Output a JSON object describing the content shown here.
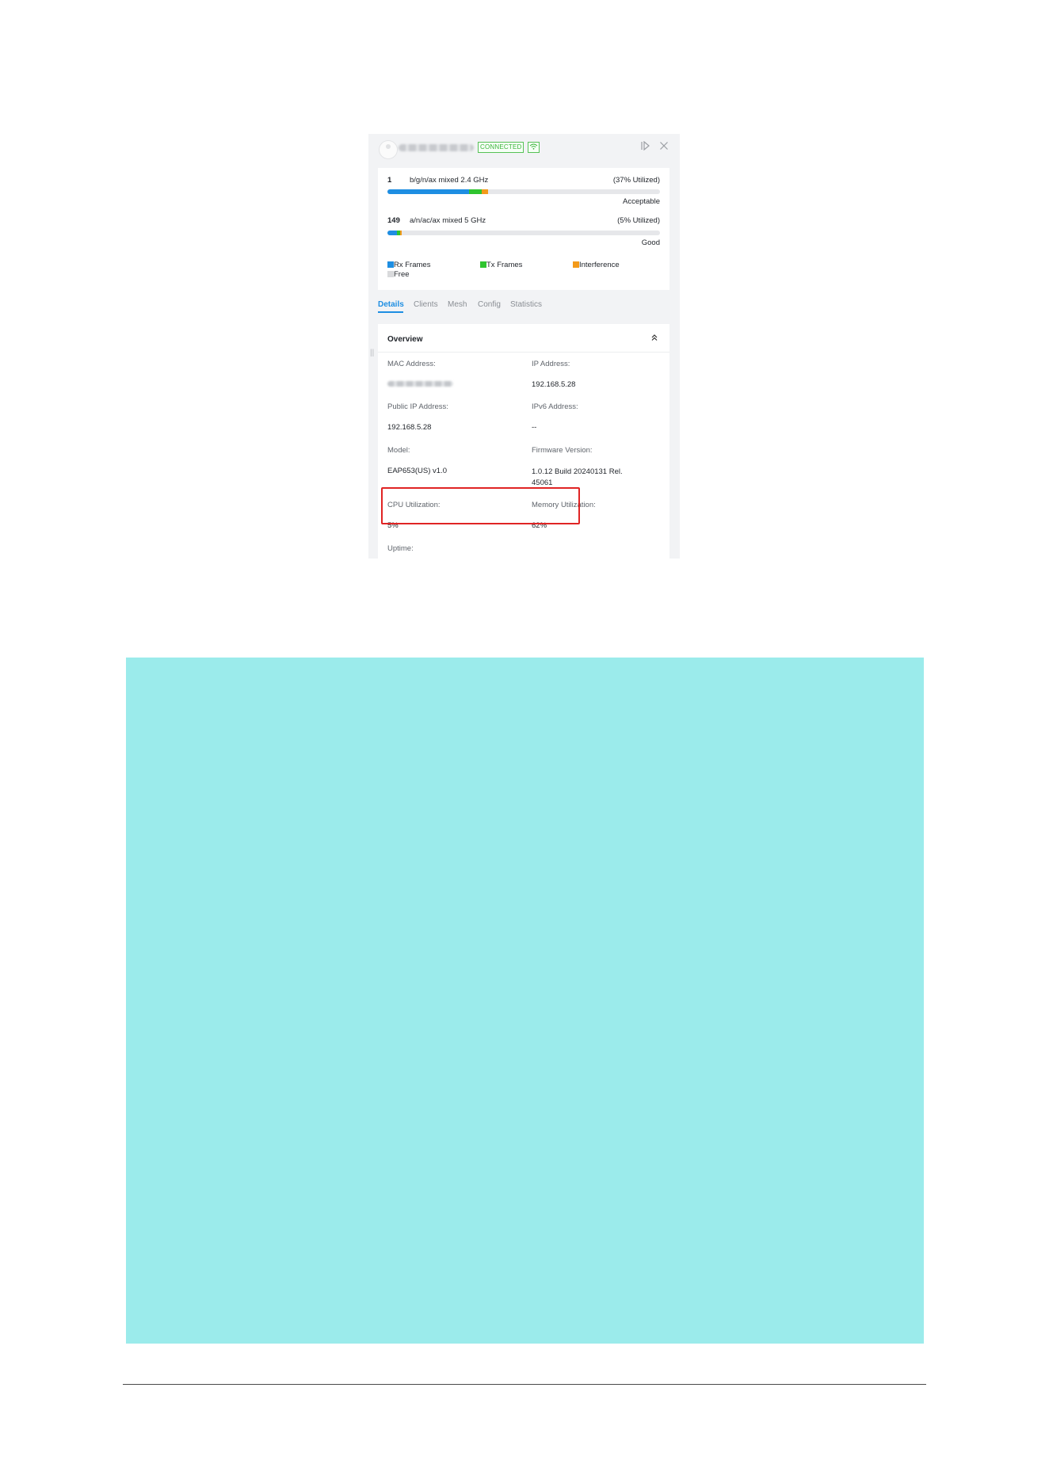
{
  "header": {
    "status_badge": "CONNECTED",
    "wifi_icon": "wifi-icon",
    "collapse_panel_icon": "panel-collapse-icon",
    "close_icon": "close-icon"
  },
  "radios": [
    {
      "channel": "1",
      "mode": "b/g/n/ax mixed  2.4 GHz",
      "utilization": "(37% Utilized)",
      "quality": "Acceptable",
      "rx_pct": 30,
      "tx_pct": 4.5,
      "interference_pct": 2.5
    },
    {
      "channel": "149",
      "mode": "a/n/ac/ax mixed  5 GHz",
      "utilization": "(5% Utilized)",
      "quality": "Good",
      "rx_pct": 3.5,
      "tx_pct": 1.2,
      "interference_pct": 0.5
    }
  ],
  "legend": {
    "rx": "Rx Frames",
    "tx": "Tx Frames",
    "interference": "Interference",
    "free": "Free"
  },
  "colors": {
    "rx": "#1e8ee2",
    "tx": "#2fc42f",
    "interference": "#f39a1a",
    "free": "#d9dadc",
    "accent": "#1e8ee2",
    "highlight": "#e02424",
    "background_block": "#9bebeb"
  },
  "tabs": [
    "Details",
    "Clients",
    "Mesh",
    "Config",
    "Statistics"
  ],
  "active_tab": "Details",
  "overview": {
    "title": "Overview",
    "mac_label": "MAC Address:",
    "ip_label": "IP Address:",
    "ip_value": "192.168.5.28",
    "public_ip_label": "Public IP Address:",
    "public_ip_value": "192.168.5.28",
    "ipv6_label": "IPv6 Address:",
    "ipv6_value": "--",
    "model_label": "Model:",
    "model_value": "EAP653(US) v1.0",
    "firmware_label": "Firmware Version:",
    "firmware_value": "1.0.12 Build 20240131 Rel. 45061",
    "cpu_label": "CPU Utilization:",
    "cpu_value": "5%",
    "memory_label": "Memory Utilization:",
    "memory_value": "62%",
    "uptime_label": "Uptime:"
  }
}
